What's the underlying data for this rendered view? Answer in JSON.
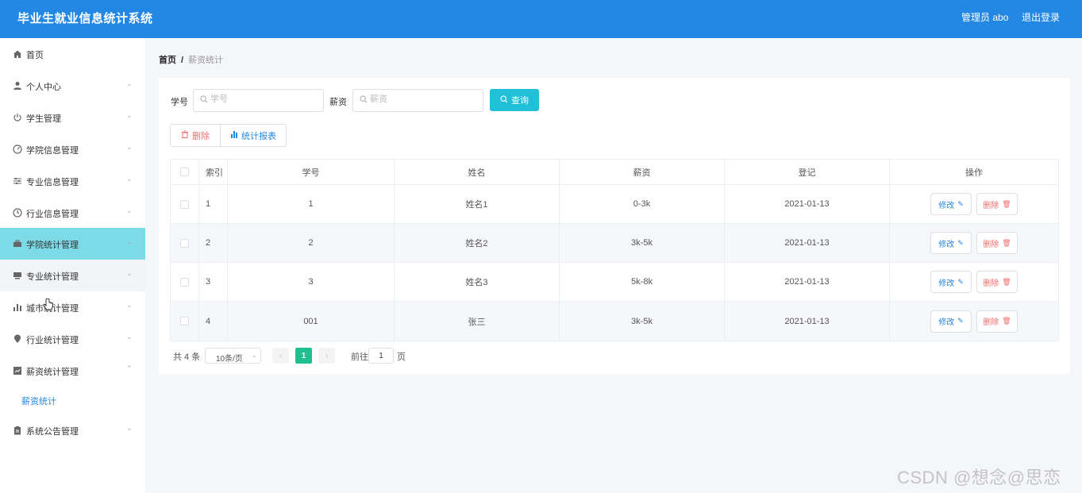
{
  "header": {
    "title": "毕业生就业信息统计系统",
    "user": "管理员 abo",
    "logout": "退出登录"
  },
  "sidebar": {
    "items": [
      {
        "label": "首页",
        "icon": "home-icon",
        "glyph": "⌂"
      },
      {
        "label": "个人中心",
        "icon": "user-icon",
        "glyph": "●"
      },
      {
        "label": "学生管理",
        "icon": "power-icon",
        "glyph": "⏻"
      },
      {
        "label": "学院信息管理",
        "icon": "gauge-icon",
        "glyph": "◔"
      },
      {
        "label": "专业信息管理",
        "icon": "sliders-icon",
        "glyph": "☰"
      },
      {
        "label": "行业信息管理",
        "icon": "clock-icon",
        "glyph": "◷"
      },
      {
        "label": "学院统计管理",
        "icon": "briefcase-icon",
        "glyph": "▬"
      },
      {
        "label": "专业统计管理",
        "icon": "monitor-icon",
        "glyph": "▬"
      },
      {
        "label": "城市统计管理",
        "icon": "bar-chart-icon",
        "glyph": "▥"
      },
      {
        "label": "行业统计管理",
        "icon": "location-icon",
        "glyph": "●"
      },
      {
        "label": "薪资统计管理",
        "icon": "trend-chart-icon",
        "glyph": "▨"
      },
      {
        "label": "系统公告管理",
        "icon": "clipboard-icon",
        "glyph": "▤"
      }
    ],
    "sub_item": "薪资统计"
  },
  "breadcrumb": {
    "home": "首页",
    "separator": "/",
    "current": "薪资统计"
  },
  "search": {
    "student_id_label": "学号",
    "student_id_placeholder": "学号",
    "salary_label": "薪资",
    "salary_placeholder": "薪资",
    "query_button": "查询"
  },
  "actions": {
    "delete": "删除",
    "report": "统计报表"
  },
  "table": {
    "columns": [
      "索引",
      "学号",
      "姓名",
      "薪资",
      "登记",
      "操作"
    ],
    "rows": [
      {
        "index": "1",
        "student_id": "1",
        "name": "姓名1",
        "salary": "0-3k",
        "date": "2021-01-13"
      },
      {
        "index": "2",
        "student_id": "2",
        "name": "姓名2",
        "salary": "3k-5k",
        "date": "2021-01-13"
      },
      {
        "index": "3",
        "student_id": "3",
        "name": "姓名3",
        "salary": "5k-8k",
        "date": "2021-01-13"
      },
      {
        "index": "4",
        "student_id": "001",
        "name": "张三",
        "salary": "3k-5k",
        "date": "2021-01-13"
      }
    ],
    "edit_label": "修改",
    "delete_label": "删除"
  },
  "pagination": {
    "total": "共 4 条",
    "page_size": "10条/页",
    "current_page": "1",
    "goto_label": "前往",
    "goto_value": "1",
    "page_label": "页"
  },
  "watermark": "CSDN @想念@思恋",
  "colors": {
    "header": "#2387e4",
    "active_menu": "#7ddbe8",
    "query_button": "#1fc0d8",
    "current_page": "#1fbf8f",
    "danger": "#f56c6c"
  }
}
